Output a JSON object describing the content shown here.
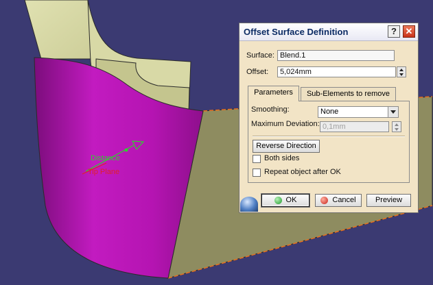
{
  "dialog": {
    "title": "Offset Surface Definition",
    "help_glyph": "?",
    "close_glyph": "✕",
    "surface_label": "Surface:",
    "surface_value": "Blend.1",
    "offset_label": "Offset:",
    "offset_value": "5,024mm",
    "tabs": [
      {
        "label": "Parameters"
      },
      {
        "label": "Sub-Elements to remove"
      }
    ],
    "smoothing_label": "Smoothing:",
    "smoothing_value": "None",
    "max_dev_label": "Maximum Deviation:",
    "max_dev_value": "0,1mm",
    "reverse_direction": "Reverse Direction",
    "both_sides": "Both sides",
    "repeat_object": "Repeat object after OK",
    "ok": "OK",
    "cancel": "Cancel",
    "preview": "Preview"
  },
  "viewport": {
    "annotation_distance": "Distance",
    "annotation_plane": "Tip Plane",
    "colors": {
      "background": "#3b3a72",
      "surface_magenta": "#c21bc0",
      "part_khaki": "#8e8c60",
      "part_light": "#d6d7a5"
    }
  }
}
